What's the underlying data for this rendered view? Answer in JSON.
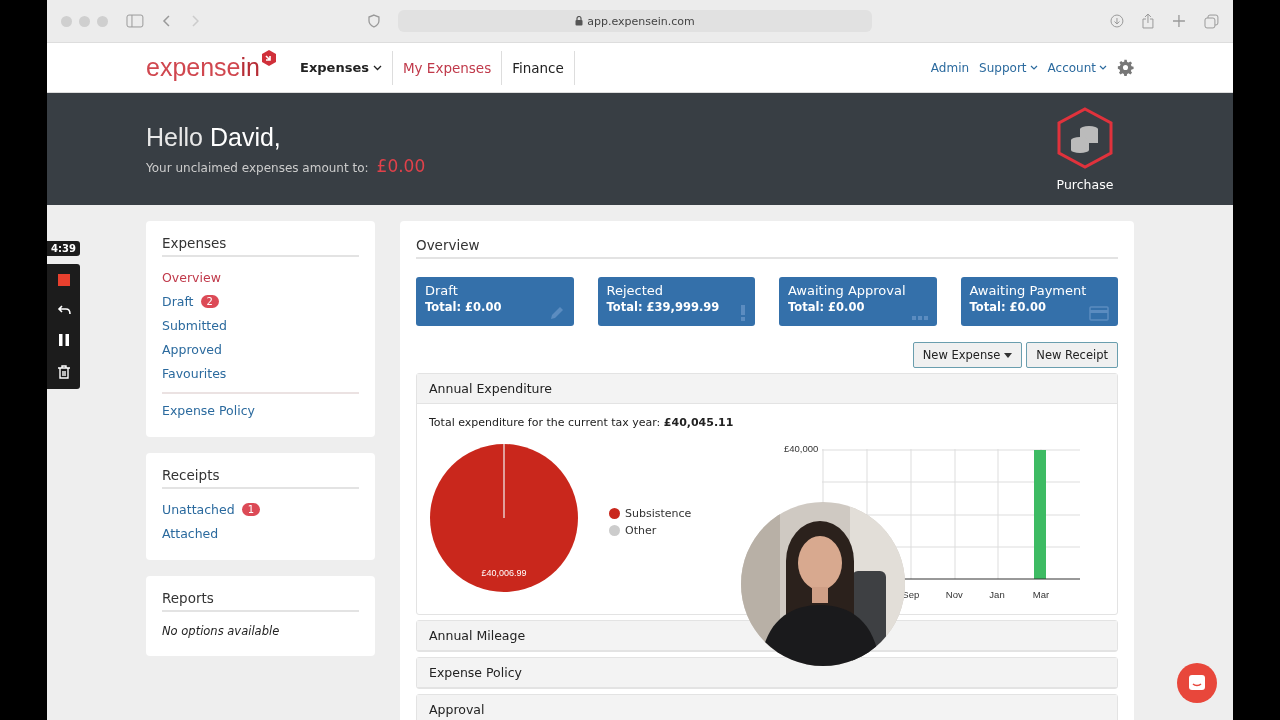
{
  "browser": {
    "url": "app.expensein.com"
  },
  "nav": {
    "logo": {
      "part_1": "expense",
      "part_2": "in"
    },
    "menu": [
      {
        "label": "Expenses",
        "dropdown": true,
        "selected": false
      },
      {
        "label": "My Expenses",
        "dropdown": false,
        "selected": true
      },
      {
        "label": "Finance",
        "dropdown": false,
        "selected": false
      }
    ],
    "links": [
      {
        "label": "Admin",
        "dropdown": false
      },
      {
        "label": "Support",
        "dropdown": true
      },
      {
        "label": "Account",
        "dropdown": true
      }
    ]
  },
  "header": {
    "greeting": "Hello",
    "name": "David,",
    "subtitle": "Your unclaimed expenses amount to:",
    "amount": "£0.00",
    "action": "Purchase"
  },
  "recorder": {
    "time": "4:39"
  },
  "sidebar": [
    {
      "title": "Expenses",
      "groups": [
        [
          {
            "label": "Overview",
            "selected": true
          },
          {
            "label": "Draft",
            "selected": false,
            "badge": "2"
          },
          {
            "label": "Submitted",
            "selected": false
          },
          {
            "label": "Approved",
            "selected": false
          },
          {
            "label": "Favourites",
            "selected": false
          }
        ],
        [
          {
            "label": "Expense Policy",
            "selected": false
          }
        ]
      ]
    },
    {
      "title": "Receipts",
      "groups": [
        [
          {
            "label": "Unattached",
            "selected": false,
            "badge": "1"
          },
          {
            "label": "Attached",
            "selected": false
          }
        ]
      ]
    },
    {
      "title": "Reports",
      "empty_text": "No options available"
    }
  ],
  "overview": {
    "title": "Overview",
    "cards": [
      {
        "title": "Draft",
        "total": "Total: £0.00"
      },
      {
        "title": "Rejected",
        "total": "Total: £39,999.99"
      },
      {
        "title": "Awaiting Approval",
        "total": "Total: £0.00"
      },
      {
        "title": "Awaiting Payment",
        "total": "Total: £0.00"
      }
    ],
    "buttons": [
      {
        "label": "New Expense",
        "dropdown": true
      },
      {
        "label": "New Receipt",
        "dropdown": false
      }
    ]
  },
  "panels": [
    {
      "title": "Annual Expenditure",
      "expanded": true,
      "summary": "Total expenditure for the current tax year: **£40,045.11**",
      "pie_label": "£40,006.99",
      "legend": [
        {
          "label": "Subsistence",
          "color": "#c9271c"
        },
        {
          "label": "Other",
          "color": "#cccccc"
        }
      ],
      "bar_chart": {
        "y_tick": "£40,000",
        "x_labels": [
          "Sep",
          "Nov",
          "Jan",
          "Mar"
        ]
      }
    },
    {
      "title": "Annual Mileage",
      "expanded": false
    },
    {
      "title": "Expense Policy",
      "expanded": false
    },
    {
      "title": "Approval",
      "expanded": false
    }
  ]
}
